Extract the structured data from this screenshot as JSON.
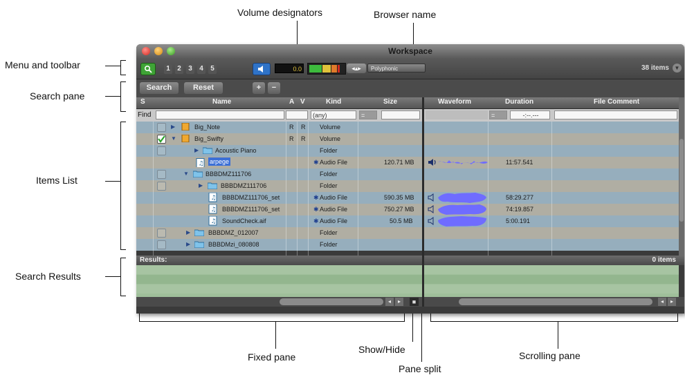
{
  "callouts": {
    "volume_designators": "Volume designators",
    "browser_name": "Browser name",
    "menu_toolbar": "Menu and toolbar",
    "search_pane": "Search pane",
    "items_list": "Items List",
    "search_results": "Search Results",
    "fixed_pane": "Fixed pane",
    "show_hide": "Show/Hide",
    "pane_split": "Pane split",
    "scrolling_pane": "Scrolling pane"
  },
  "window": {
    "title": "Workspace"
  },
  "toolbar": {
    "view_buttons": [
      "1",
      "2",
      "3",
      "4",
      "5"
    ],
    "level_readout": "0.0",
    "mode_select": "Polyphonic",
    "items_count": "38 items"
  },
  "search": {
    "search_label": "Search",
    "reset_label": "Reset",
    "add_label": "+",
    "remove_label": "−"
  },
  "columns": {
    "s": "S",
    "name": "Name",
    "a": "A",
    "v": "V",
    "kind": "Kind",
    "size": "Size",
    "waveform": "Waveform",
    "duration": "Duration",
    "file_comment": "File Comment"
  },
  "find": {
    "label": "Find",
    "kind_value": "(any)",
    "size_op": "=",
    "duration_op": "=",
    "duration_placeholder": "-:--.---"
  },
  "rows": [
    {
      "name": "Big_Note",
      "a": "R",
      "v": "R",
      "kind": "Volume",
      "size": "",
      "duration": "",
      "icon": "volume-icon",
      "indent": 0,
      "triangle": "right",
      "checked": false
    },
    {
      "name": "Big_Swifty",
      "a": "R",
      "v": "R",
      "kind": "Volume",
      "size": "",
      "duration": "",
      "icon": "volume-icon",
      "indent": 0,
      "triangle": "down",
      "checked": true
    },
    {
      "name": "Acoustic Piano",
      "a": "",
      "v": "",
      "kind": "Folder",
      "size": "",
      "duration": "",
      "icon": "folder-icon",
      "indent": 1,
      "triangle": "right",
      "checked": false
    },
    {
      "name": "arpege",
      "a": "",
      "v": "",
      "kind": "Audio File",
      "size": "120.71 MB",
      "duration": "11:57.541",
      "icon": "audio-file-icon",
      "indent": 2,
      "triangle": "",
      "checked": null,
      "selected": true
    },
    {
      "name": "BBBDMZ111706",
      "a": "",
      "v": "",
      "kind": "Folder",
      "size": "",
      "duration": "",
      "icon": "folder-icon",
      "indent": 1,
      "triangle": "down",
      "checked": false
    },
    {
      "name": "BBBDMZ111706",
      "a": "",
      "v": "",
      "kind": "Folder",
      "size": "",
      "duration": "",
      "icon": "folder-icon",
      "indent": 2,
      "triangle": "right",
      "checked": false
    },
    {
      "name": "BBBDMZ111706_set",
      "a": "",
      "v": "",
      "kind": "Audio File",
      "size": "590.35 MB",
      "duration": "58:29.277",
      "icon": "audio-file-icon",
      "indent": 3,
      "triangle": "",
      "checked": null
    },
    {
      "name": "BBBDMZ111706_set",
      "a": "",
      "v": "",
      "kind": "Audio File",
      "size": "750.27 MB",
      "duration": "74:19.857",
      "icon": "audio-file-icon",
      "indent": 3,
      "triangle": "",
      "checked": null
    },
    {
      "name": "SoundCheck.aif",
      "a": "",
      "v": "",
      "kind": "Audio File",
      "size": "50.5 MB",
      "duration": "5:00.191",
      "icon": "audio-file-icon",
      "indent": 3,
      "triangle": "",
      "checked": null
    },
    {
      "name": "BBBDMZ_012007",
      "a": "",
      "v": "",
      "kind": "Folder",
      "size": "",
      "duration": "",
      "icon": "folder-icon",
      "indent": 1,
      "triangle": "right",
      "checked": false
    },
    {
      "name": "BBBDMzi_080808",
      "a": "",
      "v": "",
      "kind": "Folder",
      "size": "",
      "duration": "",
      "icon": "folder-icon",
      "indent": 1,
      "triangle": "right",
      "checked": false
    }
  ],
  "results": {
    "label": "Results:",
    "count": "0 items"
  },
  "colors": {
    "row_blue": "#96aebd",
    "row_tan": "#b0aea3",
    "results_green": "#9fbf9a",
    "waveform": "#6f6cff",
    "selection": "#3b6fd6"
  }
}
